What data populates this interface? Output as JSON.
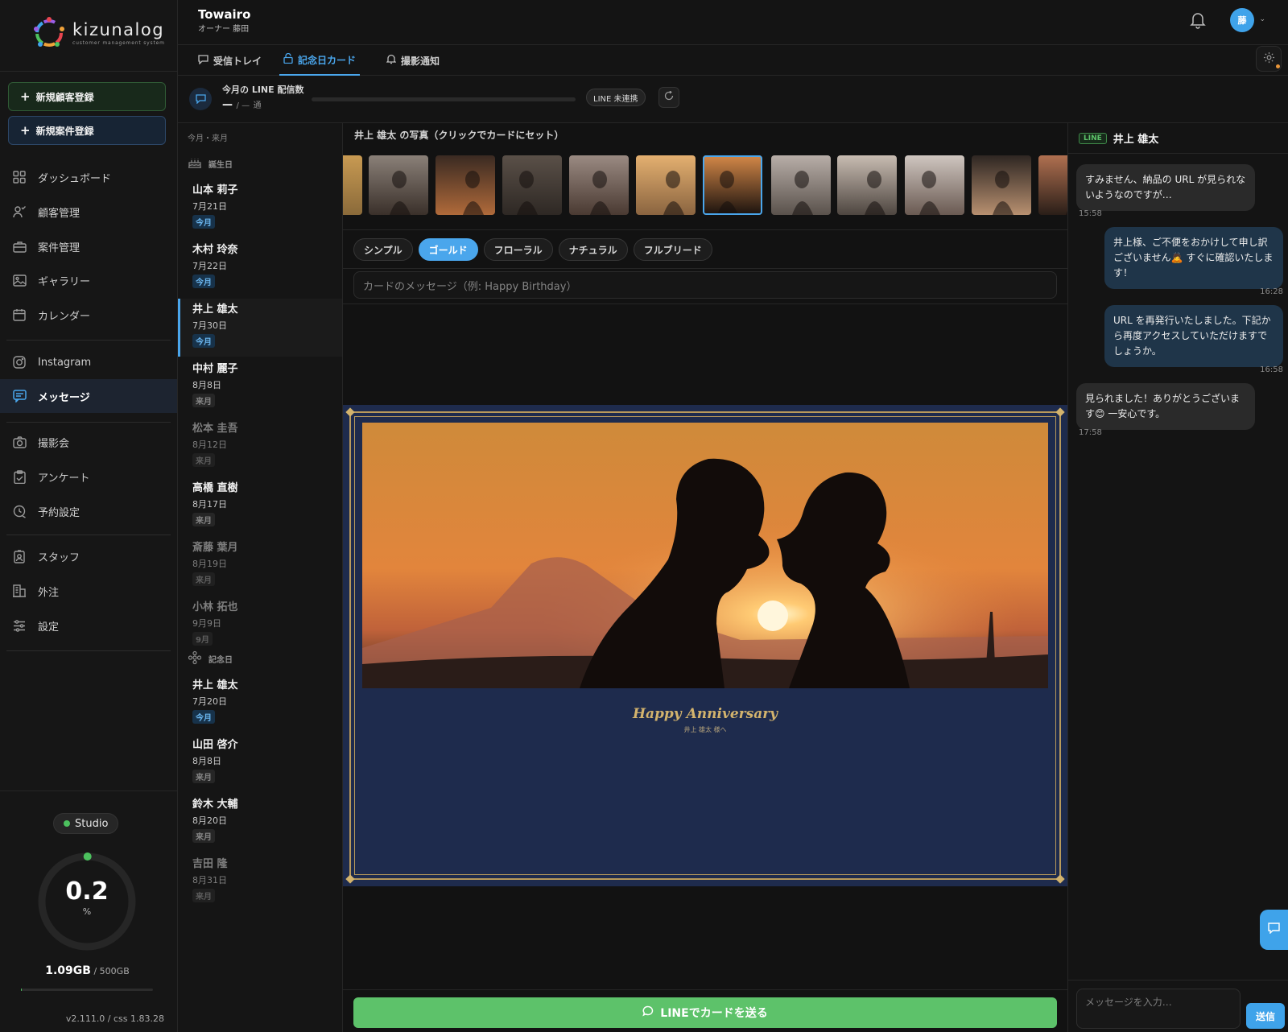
{
  "brand": {
    "name": "kizunalog",
    "tagline": "customer management system"
  },
  "sidebar": {
    "new_customer": "新規顧客登録",
    "new_case": "新規案件登録",
    "nav": [
      {
        "label": "ダッシュボード",
        "icon": "grid-icon"
      },
      {
        "label": "顧客管理",
        "icon": "users-icon"
      },
      {
        "label": "案件管理",
        "icon": "briefcase-icon"
      },
      {
        "label": "ギャラリー",
        "icon": "image-icon"
      },
      {
        "label": "カレンダー",
        "icon": "calendar-icon"
      },
      {
        "label": "Instagram",
        "icon": "instagram-icon"
      },
      {
        "label": "メッセージ",
        "icon": "message-icon"
      },
      {
        "label": "撮影会",
        "icon": "camera-icon"
      },
      {
        "label": "アンケート",
        "icon": "clipboard-icon"
      },
      {
        "label": "予約設定",
        "icon": "clock-icon"
      },
      {
        "label": "スタッフ",
        "icon": "badge-icon"
      },
      {
        "label": "外注",
        "icon": "building-icon"
      },
      {
        "label": "設定",
        "icon": "sliders-icon"
      }
    ],
    "plan": "Studio",
    "usage_value": "0.2",
    "usage_unit": "%",
    "usage_fraction": 0.002,
    "storage_used": "1.09GB",
    "storage_total": " / 500GB",
    "version": "v2.111.0 / css 1.83.28"
  },
  "header": {
    "studio": "Towairo",
    "owner": "オーナー  藤田",
    "avatar_initial": "藤"
  },
  "tabs": [
    {
      "label": "受信トレイ",
      "icon": "chat-icon"
    },
    {
      "label": "記念日カード",
      "icon": "lock-icon"
    },
    {
      "label": "撮影通知",
      "icon": "bell-icon"
    }
  ],
  "usage": {
    "label": "今月の LINE 配信数",
    "count": "—",
    "limit": "—",
    "unit": "通",
    "line_status": "LINE 未連携"
  },
  "list": {
    "period": "今月・来月",
    "birthday_heading": "誕生日",
    "anniversary_heading": "記念日",
    "birthdays": [
      {
        "name": "山本 莉子",
        "date": "7月21日",
        "tag": "今月"
      },
      {
        "name": "木村 玲奈",
        "date": "7月22日",
        "tag": "今月"
      },
      {
        "name": "井上 雄太",
        "date": "7月30日",
        "tag": "今月"
      },
      {
        "name": "中村 麗子",
        "date": "8月8日",
        "tag": "来月"
      },
      {
        "name": "松本 圭吾",
        "date": "8月12日",
        "tag": "来月"
      },
      {
        "name": "高橋 直樹",
        "date": "8月17日",
        "tag": "来月"
      },
      {
        "name": "斎藤 葉月",
        "date": "8月19日",
        "tag": "来月"
      },
      {
        "name": "小林 拓也",
        "date": "9月9日",
        "tag": "9月"
      }
    ],
    "anniversaries": [
      {
        "name": "井上 雄太",
        "date": "7月20日",
        "tag": "今月"
      },
      {
        "name": "山田 啓介",
        "date": "8月8日",
        "tag": "来月"
      },
      {
        "name": "鈴木 大輔",
        "date": "8月20日",
        "tag": "来月"
      },
      {
        "name": "吉田 隆",
        "date": "8月31日",
        "tag": "来月"
      }
    ]
  },
  "editor": {
    "photos_title": "井上 雄太 の写真（クリックでカードにセット）",
    "styles": [
      "シンプル",
      "ゴールド",
      "フローラル",
      "ナチュラル",
      "フルブリード"
    ],
    "message_placeholder": "カードのメッセージ（例: Happy Birthday）",
    "card_title": "Happy Anniversary",
    "card_recipient": "井上 雄太 様へ",
    "send_label": "LINEでカードを送る"
  },
  "chat": {
    "badge": "LINE",
    "name": "井上 雄太",
    "messages": [
      {
        "text": "すみません、納品の URL が見られないようなのですが…",
        "time": "15:58"
      },
      {
        "text": "井上様、ご不便をおかけして申し訳ございません🙇 すぐに確認いたします！",
        "time": "16:28"
      },
      {
        "text": "URL を再発行いたしました。下記から再度アクセスしていただけますでしょうか。",
        "time": "16:58"
      },
      {
        "text": "見られました！ありがとうございます😊 一安心です。",
        "time": "17:58"
      }
    ],
    "input_placeholder": "メッセージを入力…",
    "send": "送信"
  }
}
